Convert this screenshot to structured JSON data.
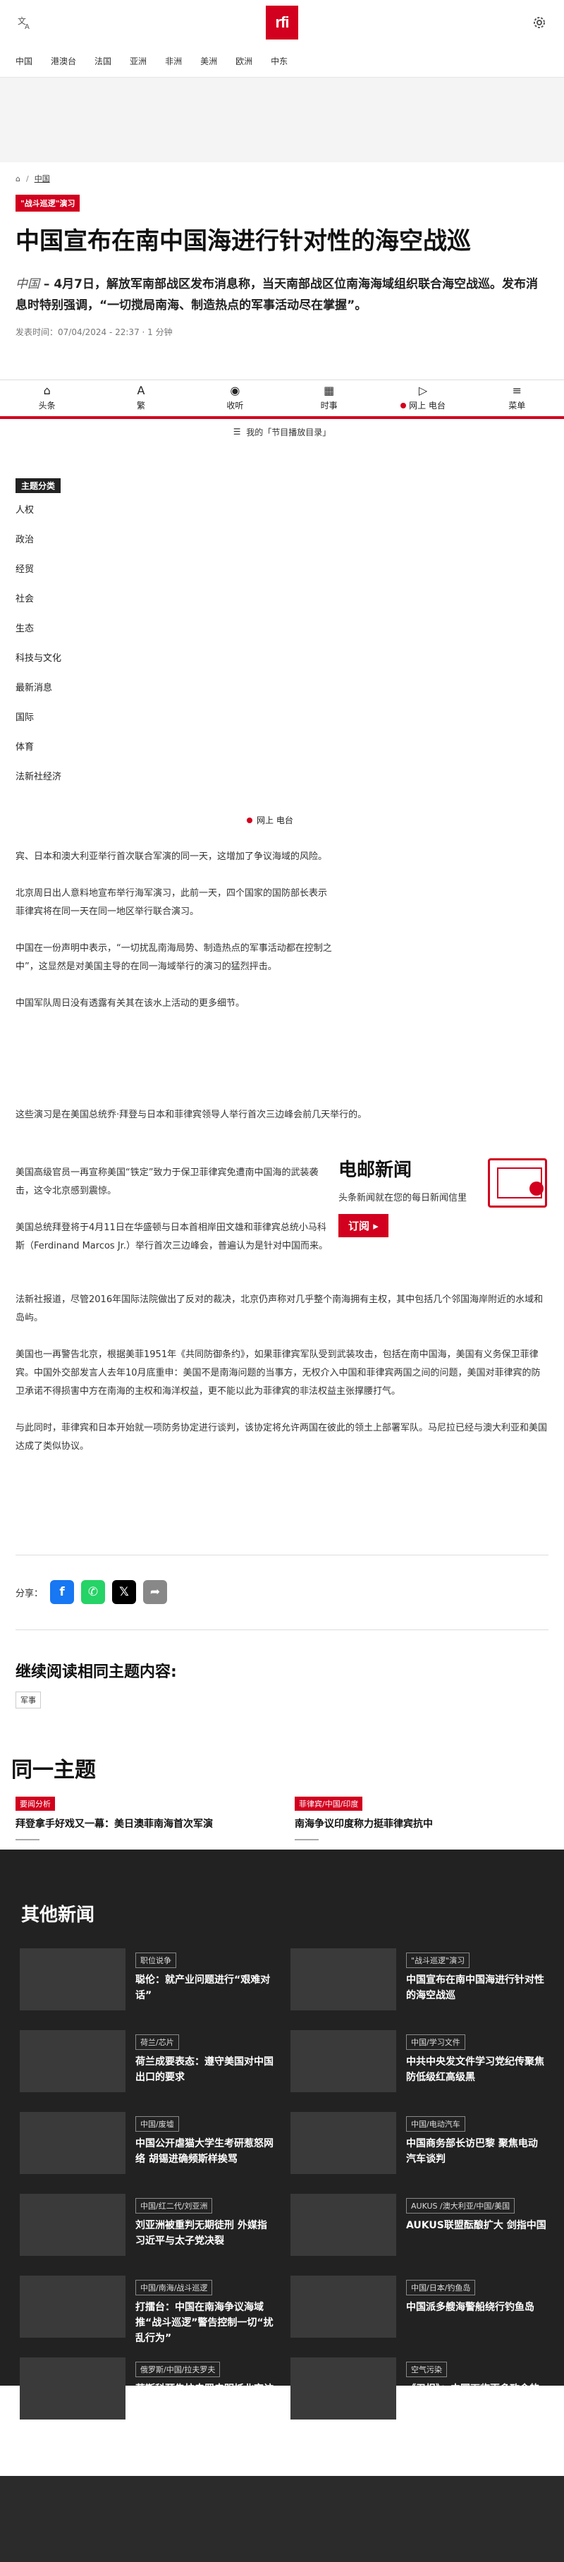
{
  "header": {
    "logo": "rfi",
    "lang_icon": "translate-icon",
    "settings_icon": "gear-icon"
  },
  "nav": [
    "中国",
    "港澳台",
    "法国",
    "亚洲",
    "非洲",
    "美洲",
    "欧洲",
    "中东"
  ],
  "breadcrumb": {
    "category": "中国"
  },
  "article": {
    "tag": "\"战斗巡逻\"演习",
    "title": "中国宣布在南中国海进行针对性的海空战巡",
    "source": "中国",
    "lead": " – 4月7日，解放军南部战区发布消息称，当天南部战区位南海海域组织联合海空战巡。发布消息时特别强调，“一切搅局南海、制造热点的军事活动尽在掌握”。",
    "meta": "发表时间：07/04/2024 - 22:37 · 1 分钟"
  },
  "tabbar": [
    {
      "label": "头条",
      "icon": "home-icon",
      "glyph": "⌂"
    },
    {
      "label": "繁",
      "icon": "text-icon",
      "glyph": "A"
    },
    {
      "label": "收听",
      "icon": "podcast-icon",
      "glyph": "◉"
    },
    {
      "label": "时事",
      "icon": "calendar-icon",
      "glyph": "▦"
    },
    {
      "label": "网上 电台",
      "icon": "play-icon",
      "glyph": "▷"
    },
    {
      "label": "菜单",
      "icon": "menu-icon",
      "glyph": "≡"
    }
  ],
  "programs": "我的「节目播放目录」",
  "menu": {
    "heading": "主题分类",
    "items": [
      "人权",
      "政治",
      "经贸",
      "社会",
      "生态",
      "科技与文化",
      "最新消息",
      "国际",
      "体育",
      "法新社经济"
    ]
  },
  "live_label": "网上 电台",
  "body_narrow": [
    "宾、日本和澳大利亚举行首次联合军演的同一天，这增加了争议海域的风险。",
    "北京周日出人意料地宣布举行海军演习，此前一天，四个国家的国防部长表示菲律宾将在同一天在同一地区举行联合演习。",
    "中国在一份声明中表示，“一切扰乱南海局势、制造热点的军事活动都在控制之中”，这显然是对美国主导的在同一海域举行的演习的猛烈抨击。",
    "中国军队周日没有透露有关其在该水上活动的更多细节。"
  ],
  "body_wide1": "这些演习是在美国总统乔·拜登与日本和菲律宾领导人举行首次三边峰会前几天举行的。",
  "body_narrow2": [
    "美国高级官员一再宣称美国“铁定”致力于保卫菲律宾免遭南中国海的武装袭击，这令北京感到震惊。",
    "美国总统拜登将于4月11日在华盛顿与日本首相岸田文雄和菲律宾总统小马科斯（Ferdinand Marcos Jr.）举行首次三边峰会，普遍认为是针对中国而来。"
  ],
  "body_wide2": [
    "法新社报道，尽管2016年国际法院做出了反对的裁决，北京仍声称对几乎整个南海拥有主权，其中包括几个邻国海岸附近的水域和岛屿。",
    "美国也一再警告北京，根据美菲1951年《共同防御条约》，如果菲律宾军队受到武装攻击，包括在南中国海，美国有义务保卫菲律宾。中国外交部发言人去年10月底重申：美国不是南海问题的当事方，无权介入中国和菲律宾两国之间的问题，美国对菲律宾的防卫承诺不得损害中方在南海的主权和海洋权益，更不能以此为菲律宾的非法权益主张撑腰打气。",
    "与此同时，菲律宾和日本开始就一项防务协定进行谈判，该协定将允许两国在彼此的领土上部署军队。马尼拉已经与澳大利亚和美国达成了类似协议。"
  ],
  "newsletter": {
    "title": "电邮新闻",
    "desc": "头条新闻就在您的每日新闻信里",
    "button": "订阅 ▸"
  },
  "share": {
    "label": "分享："
  },
  "continue_title": "继续阅读相同主题内容:",
  "continue_chip": "军事",
  "same_topic": {
    "title": "同一主题",
    "cards": [
      {
        "label": "要闻分析",
        "title": "拜登拿手好戏又一幕：美日澳菲南海首次军演"
      },
      {
        "label": "菲律宾/中国/印度",
        "title": "南海争议印度称力挺菲律宾抗中"
      }
    ]
  },
  "other_news": {
    "title": "其他新闻",
    "cards": [
      {
        "label": "职位说争",
        "title": "聪伦：就产业问题进行“艰难对话”"
      },
      {
        "label": "\"战斗巡逻\"演习",
        "title": "中国宣布在南中国海进行针对性的海空战巡"
      },
      {
        "label": "荷兰/芯片",
        "title": "荷兰成要表态：遵守美国对中国出口的要求"
      },
      {
        "label": "中国/学习文件",
        "title": "中共中央发文件学习党纪传聚焦防低级红高级黑"
      },
      {
        "label": "中国/废墟",
        "title": "中国公开虐猫大学生考研惹怒网络 胡锡进确频斯样挨骂"
      },
      {
        "label": "中国/电动汽车",
        "title": "中国商务部长访巴黎 聚焦电动汽车谈判"
      },
      {
        "label": "中国/红二代/刘亚洲",
        "title": "刘亚洲被重判无期徒刑 外媒指习近平与太子党决裂"
      },
      {
        "label": "AUKUS /澳大利亚/中国/美国",
        "title": "AUKUS联盟酝酿扩大 剑指中国"
      },
      {
        "label": "中国/南海/战斗巡逻",
        "title": "打擂台：中国在南海争议海域推“战斗巡逻”警告控制一切“扰乱行为”"
      },
      {
        "label": "中国/日本/钓鱼岛",
        "title": "中国派多艘海警船绕行钓鱼岛"
      },
      {
        "label": "俄罗斯/中国/拉夫罗夫",
        "title": "莫斯科预告拉夫罗夫明抵北京访问"
      },
      {
        "label": "空气污染",
        "title": "《卫报》：中国面临更多致命的空气污染"
      }
    ]
  }
}
